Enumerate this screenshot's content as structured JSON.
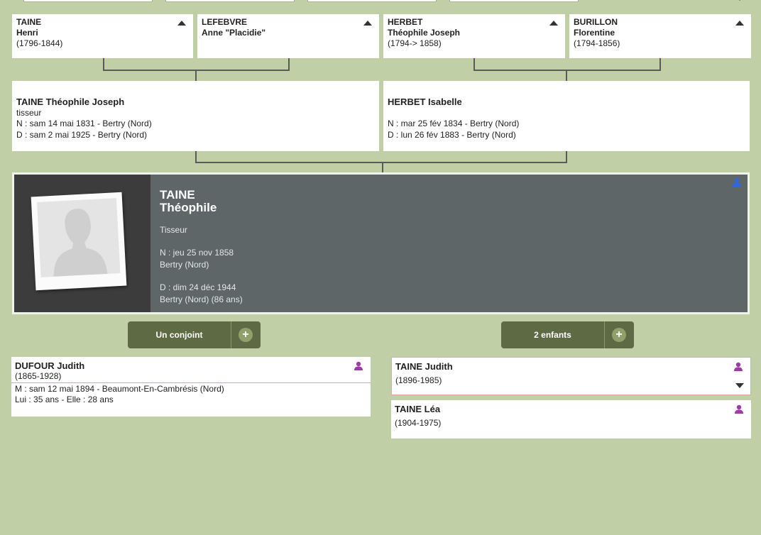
{
  "colors": {
    "background": "#c0cfa6",
    "card": "#ffffff",
    "main_card": "#5f6667",
    "button": "#5d6a44",
    "user_icon_blue": "#2b6ad8",
    "user_icon_purple": "#a03aa8"
  },
  "grandparents": [
    {
      "surname": "TAINE",
      "given": "Henri",
      "dates": "(1796-1844)"
    },
    {
      "surname": "LEFEBVRE",
      "given": "Anne \"Placidie\"",
      "dates": ""
    },
    {
      "surname": "HERBET",
      "given": "Théophile Joseph",
      "dates": "(1794-> 1858)"
    },
    {
      "surname": "BURILLON",
      "given": "Florentine",
      "dates": "(1794-1856)"
    }
  ],
  "parents": [
    {
      "name": "TAINE Théophile Joseph",
      "occupation": "tisseur",
      "birth": "N : sam 14 mai 1831 - Bertry (Nord)",
      "death": "D : sam 2 mai 1925 - Bertry (Nord)"
    },
    {
      "name": "HERBET Isabelle",
      "occupation": "",
      "birth": "N : mar 25 fév 1834 - Bertry (Nord)",
      "death": "D : lun 26 fév 1883 - Bertry (Nord)"
    }
  ],
  "person": {
    "surname": "TAINE",
    "given": "Théophile",
    "occupation": "Tisseur",
    "birth_date": "N : jeu 25 nov 1858",
    "birth_place": "Bertry (Nord)",
    "death_date": "D : dim 24 déc 1944",
    "death_place": "Bertry (Nord) (86 ans)"
  },
  "buttons": {
    "spouses": "Un conjoint",
    "children": "2 enfants",
    "plus": "+"
  },
  "spouse": {
    "name": "DUFOUR Judith",
    "dates": "(1865-1928)",
    "marriage": "M : sam 12 mai 1894 - Beaumont-En-Cambrésis (Nord)",
    "ages": "Lui : 35 ans - Elle : 28 ans"
  },
  "children": [
    {
      "name": "TAINE Judith",
      "dates": "(1896-1985)"
    },
    {
      "name": "TAINE Léa",
      "dates": "(1904-1975)"
    }
  ]
}
